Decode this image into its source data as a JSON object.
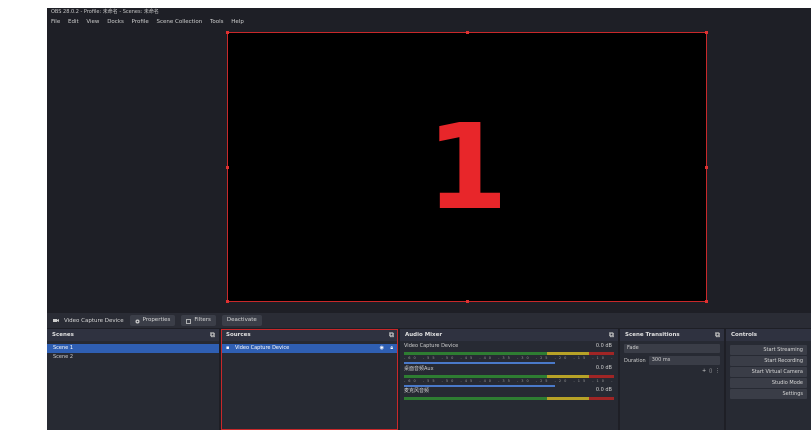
{
  "window": {
    "title": "OBS 28.0.2 - Profile: 未命名 - Scenes: 未命名",
    "menu": [
      "File",
      "Edit",
      "View",
      "Docks",
      "Profile",
      "Scene Collection",
      "Tools",
      "Help"
    ]
  },
  "preview": {
    "canvas_text": "1"
  },
  "source_toolbar": {
    "source_name": "Video Capture Device",
    "properties": "Properties",
    "filters": "Filters",
    "deactivate": "Deactivate"
  },
  "scenes": {
    "title": "Scenes",
    "items": [
      "Scene 1",
      "Scene 2"
    ],
    "selected": 0
  },
  "sources": {
    "title": "Sources",
    "items": [
      "Video Capture Device"
    ]
  },
  "mixer": {
    "title": "Audio Mixer",
    "channels": [
      {
        "name": "Video Capture Device",
        "db": "0.0 dB"
      },
      {
        "name": "桌面音频Aux",
        "db": "0.0 dB"
      },
      {
        "name": "麦克风音频",
        "db": "0.0 dB"
      }
    ],
    "ticks": "-60 -55 -50 -45 -40 -35 -30 -25 -20 -15 -10 -5 0"
  },
  "transitions": {
    "title": "Scene Transitions",
    "selected": "Fade",
    "duration_label": "Duration",
    "duration_value": "300 ms"
  },
  "controls": {
    "title": "Controls",
    "buttons": [
      "Start Streaming",
      "Start Recording",
      "Start Virtual Camera",
      "Studio Mode",
      "Settings"
    ]
  },
  "colors": {
    "accent_red": "#c8282a",
    "selection_blue": "#2f5fb3",
    "panel": "#272a33"
  }
}
